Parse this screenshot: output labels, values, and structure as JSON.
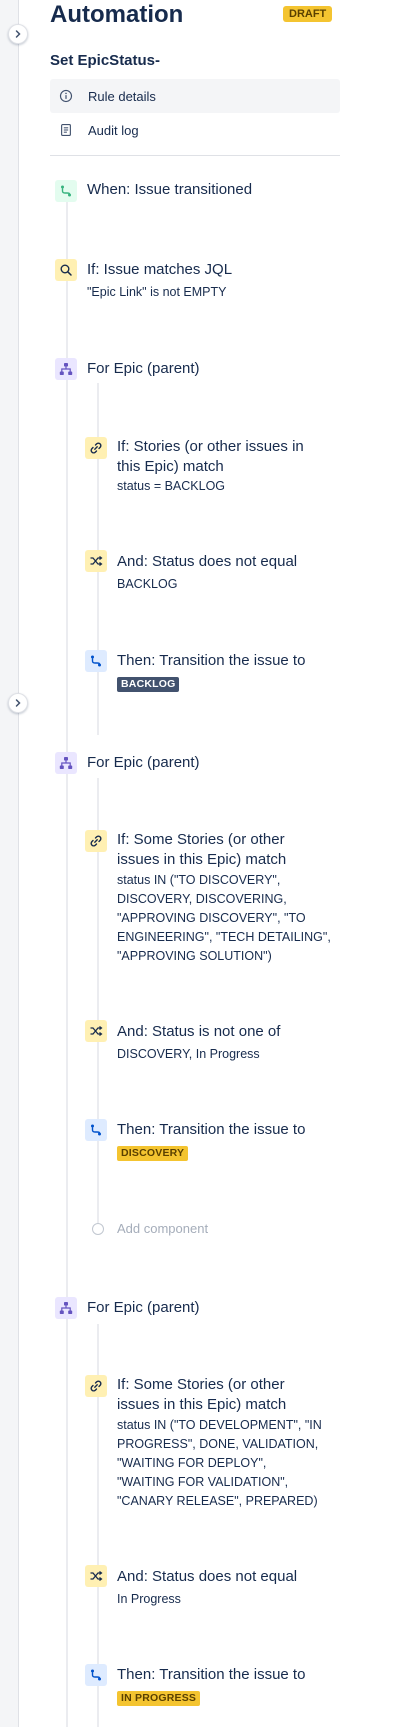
{
  "header": {
    "title": "Automation",
    "badge": "DRAFT",
    "rule_name": "Set EpicStatus-"
  },
  "nav": {
    "items": [
      {
        "label": "Rule details",
        "icon": "info-icon",
        "active": true
      },
      {
        "label": "Audit log",
        "icon": "document-icon",
        "active": false
      }
    ]
  },
  "colors": {
    "trigger": "#36b37e",
    "condition": "#fff0b3",
    "branch": "#6554c0",
    "action": "#0065ff",
    "lozenge_dark": "#42526e",
    "lozenge_yellow": "#f4c430"
  },
  "flow": {
    "trigger": {
      "title": "When: Issue transitioned",
      "icon": "trigger-icon"
    },
    "condition": {
      "title": "If: Issue matches JQL",
      "sub": "\"Epic Link\" is not EMPTY",
      "icon": "search-icon"
    },
    "branch1": {
      "title": "For Epic (parent)",
      "c1_title1": "If: Stories (or other issues in",
      "c1_title2": "this Epic) match",
      "c1_sub": "status = BACKLOG",
      "c2_title": "And: Status does not equal",
      "c2_sub": "BACKLOG",
      "a_title": "Then: Transition the issue to",
      "a_status": "BACKLOG"
    },
    "branch2": {
      "title": "For Epic (parent)",
      "c1_title1": "If: Some Stories (or other",
      "c1_title2": "issues in this Epic) match",
      "c1_sub1": "status IN (\"TO DISCOVERY\",",
      "c1_sub2": "DISCOVERY, DISCOVERING,",
      "c1_sub3": "\"APPROVING DISCOVERY\", \"TO",
      "c1_sub4": "ENGINEERING\", \"TECH DETAILING\",",
      "c1_sub5": "\"APPROVING SOLUTION\")",
      "c2_title": "And: Status is not one of",
      "c2_sub": "DISCOVERY, In Progress",
      "a_title": "Then: Transition the issue to",
      "a_status": "DISCOVERY",
      "add_label": "Add component"
    },
    "branch3": {
      "title": "For Epic (parent)",
      "c1_title1": "If: Some Stories (or other",
      "c1_title2": "issues in this Epic) match",
      "c1_sub1": "status IN (\"TO DEVELOPMENT\", \"IN",
      "c1_sub2": "PROGRESS\", DONE, VALIDATION,",
      "c1_sub3": "\"WAITING FOR DEPLOY\",",
      "c1_sub4": "\"WAITING FOR VALIDATION\",",
      "c1_sub5": "\"CANARY RELEASE\", PREPARED)",
      "c2_title": "And: Status does not equal",
      "c2_sub": "In Progress",
      "a_title": "Then: Transition the issue to",
      "a_status": "IN PROGRESS"
    }
  }
}
